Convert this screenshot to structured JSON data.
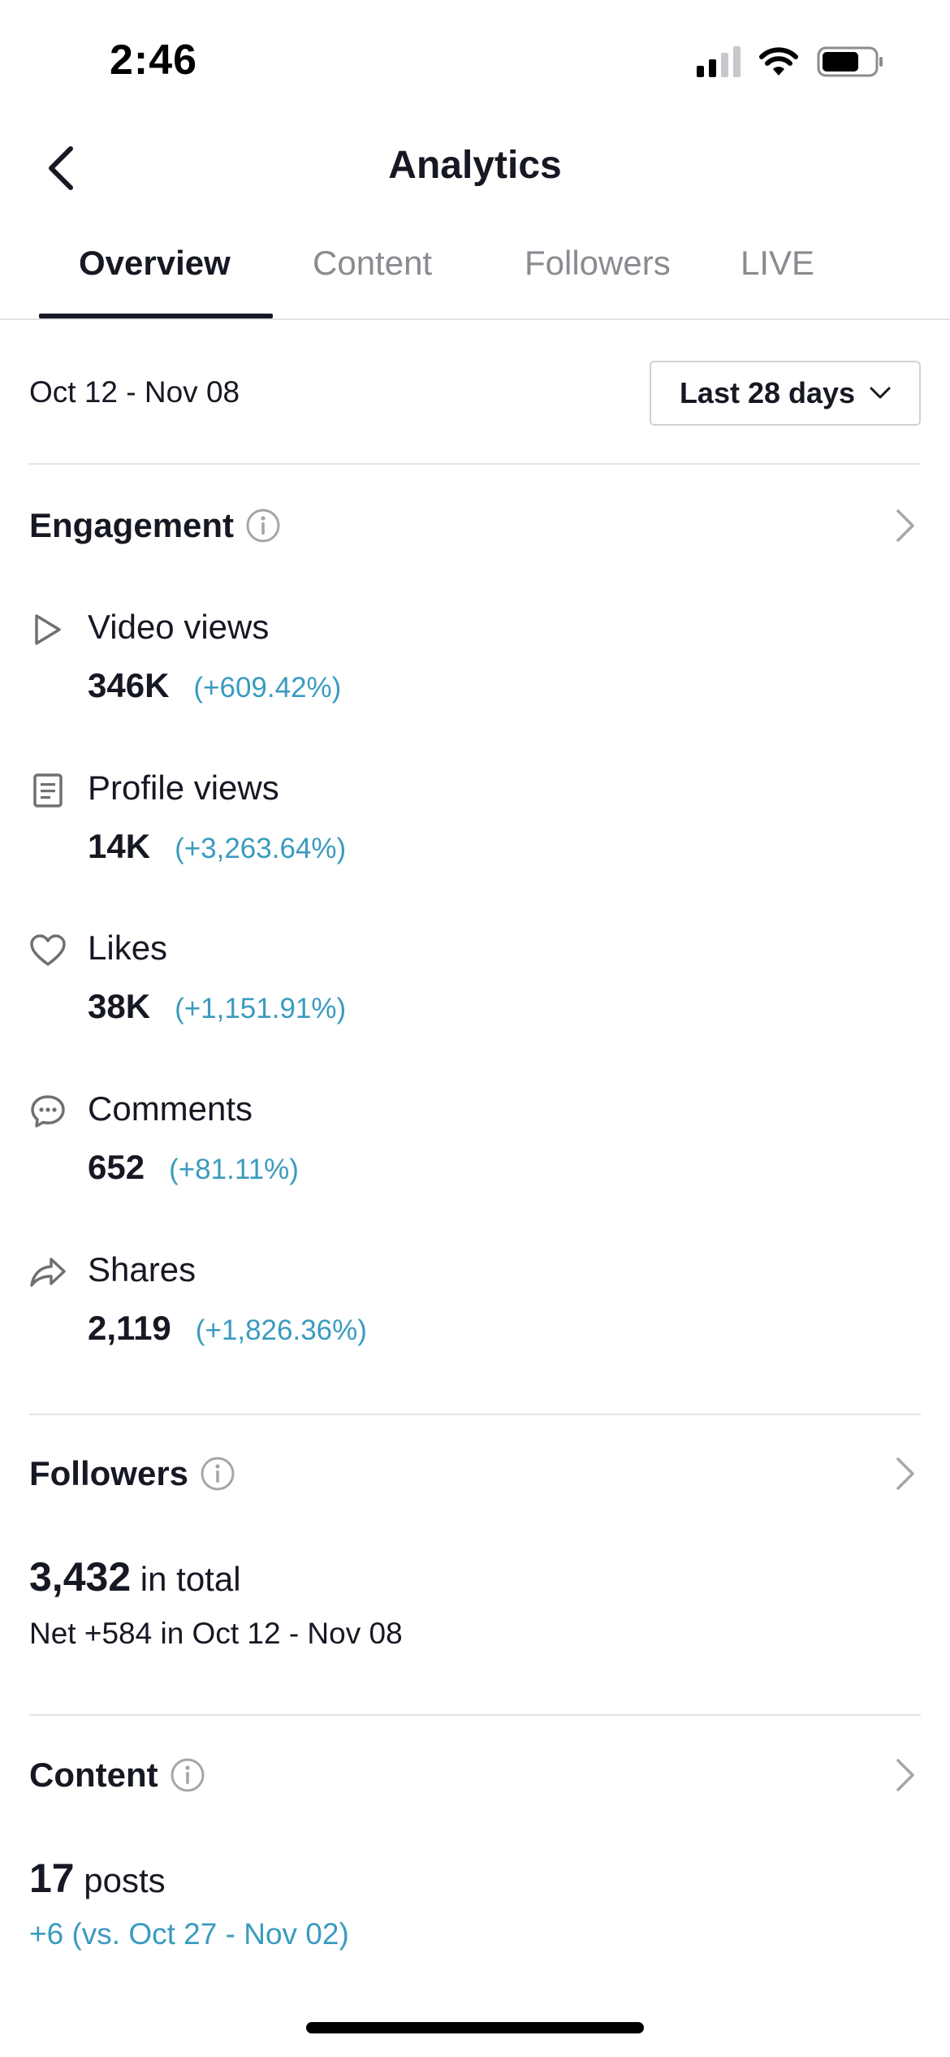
{
  "status_bar": {
    "time": "2:46",
    "icons": [
      "cellular-signal-icon",
      "wifi-icon",
      "battery-icon"
    ]
  },
  "header": {
    "title": "Analytics",
    "back_icon": "chevron-left-icon"
  },
  "tabs": [
    {
      "label": "Overview",
      "active": true
    },
    {
      "label": "Content",
      "active": false
    },
    {
      "label": "Followers",
      "active": false
    },
    {
      "label": "LIVE",
      "active": false
    }
  ],
  "date_range": "Oct 12 - Nov 08",
  "period_select": {
    "value": "Last 28 days"
  },
  "engagement": {
    "title": "Engagement",
    "metrics": [
      {
        "icon": "play-icon",
        "label": "Video views",
        "value": "346K",
        "change": "(+609.42%)"
      },
      {
        "icon": "profile-card-icon",
        "label": "Profile views",
        "value": "14K",
        "change": "(+3,263.64%)"
      },
      {
        "icon": "heart-icon",
        "label": "Likes",
        "value": "38K",
        "change": "(+1,151.91%)"
      },
      {
        "icon": "comment-icon",
        "label": "Comments",
        "value": "652",
        "change": "(+81.11%)"
      },
      {
        "icon": "share-icon",
        "label": "Shares",
        "value": "2,119",
        "change": "(+1,826.36%)"
      }
    ]
  },
  "followers": {
    "title": "Followers",
    "total": "3,432",
    "total_suffix": "in total",
    "net": "Net +584 in Oct 12 - Nov 08"
  },
  "content": {
    "title": "Content",
    "count": "17",
    "count_suffix": "posts",
    "comparison": "+6 (vs. Oct 27 - Nov 02)"
  },
  "colors": {
    "text": "#161823",
    "muted": "#8a8b91",
    "accent": "#3a9bbf",
    "divider": "#e3e3e4"
  }
}
